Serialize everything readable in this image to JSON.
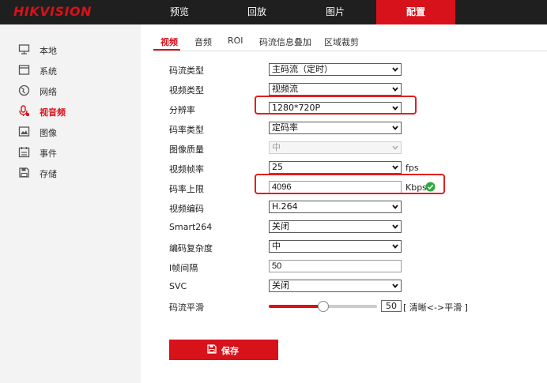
{
  "brand": "HIKVISION",
  "nav": [
    "预览",
    "回放",
    "图片",
    "配置"
  ],
  "sidebar": [
    "本地",
    "系统",
    "网络",
    "视音频",
    "图像",
    "事件",
    "存储"
  ],
  "tabs": [
    "视频",
    "音频",
    "ROI",
    "码流信息叠加",
    "区域裁剪"
  ],
  "form": {
    "stream_type": {
      "label": "码流类型",
      "value": "主码流（定时）"
    },
    "video_type": {
      "label": "视频类型",
      "value": "视频流"
    },
    "resolution": {
      "label": "分辨率",
      "value": "1280*720P"
    },
    "bitrate_type": {
      "label": "码率类型",
      "value": "定码率"
    },
    "image_quality": {
      "label": "图像质量",
      "value": "中"
    },
    "frame_rate": {
      "label": "视频帧率",
      "value": "25",
      "unit": "fps"
    },
    "max_bitrate": {
      "label": "码率上限",
      "value": "4096",
      "unit": "Kbps"
    },
    "video_encoding": {
      "label": "视频编码",
      "value": "H.264"
    },
    "smart264": {
      "label": "Smart264",
      "value": "关闭"
    },
    "encoding_complexity": {
      "label": "编码复杂度",
      "value": "中"
    },
    "i_frame_interval": {
      "label": "I帧间隔",
      "value": "50"
    },
    "svc": {
      "label": "SVC",
      "value": "关闭"
    },
    "stream_smoothing": {
      "label": "码流平滑",
      "value": "50",
      "fraction": 0.5,
      "hint": "[ 清晰<->平滑 ]"
    }
  },
  "save_label": "保存",
  "colors": {
    "accent": "#d8121b",
    "topbar": "#1f1f1f",
    "sidebar": "#f3f3f3",
    "success": "#2eaa3c",
    "highlight": "#e02020"
  }
}
